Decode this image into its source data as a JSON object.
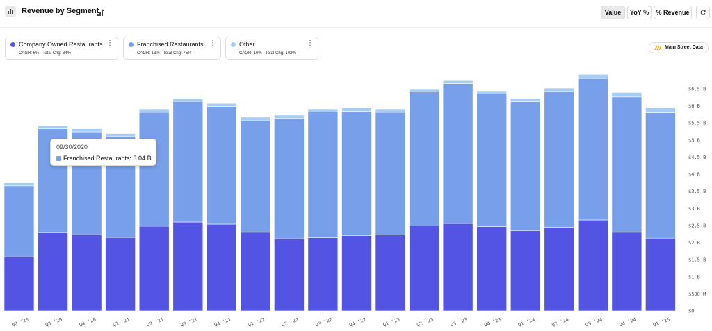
{
  "header": {
    "title": "Revenue by Segment",
    "buttons": {
      "value": "Value",
      "yoy": "YoY %",
      "pct_revenue": "% Revenue"
    }
  },
  "legend_cards": [
    {
      "name": "Company Owned Restaurants",
      "cagr": "CAGR: 6%",
      "total_chg": "Total Chg: 34%",
      "color": "#5353e4"
    },
    {
      "name": "Franchised Restaurants",
      "cagr": "CAGR: 13%",
      "total_chg": "Total Chg: 75%",
      "color": "#779fea"
    },
    {
      "name": "Other",
      "cagr": "CAGR: 16%",
      "total_chg": "Total Chg: 102%",
      "color": "#a7cdf5"
    }
  ],
  "badge": {
    "label": "Main Street Data"
  },
  "tooltip": {
    "date": "09/30/2020",
    "text": "Franchised Restaurants: 3.04 B",
    "color": "#779fea"
  },
  "chart_data": {
    "type": "bar",
    "stacked": true,
    "categories": [
      "Q2 '20",
      "Q3 '20",
      "Q4 '20",
      "Q1 '21",
      "Q2 '21",
      "Q3 '21",
      "Q4 '21",
      "Q1 '22",
      "Q2 '22",
      "Q3 '22",
      "Q4 '22",
      "Q1 '23",
      "Q2 '23",
      "Q3 '23",
      "Q4 '23",
      "Q1 '24",
      "Q2 '24",
      "Q3 '24",
      "Q4 '24",
      "Q1 '25"
    ],
    "series": [
      {
        "name": "Company Owned Restaurants",
        "color": "#5353e4",
        "values": [
          1.58,
          2.29,
          2.23,
          2.15,
          2.48,
          2.6,
          2.54,
          2.3,
          2.11,
          2.14,
          2.2,
          2.22,
          2.49,
          2.56,
          2.47,
          2.35,
          2.45,
          2.66,
          2.3,
          2.13
        ]
      },
      {
        "name": "Franchised Restaurants",
        "color": "#779fea",
        "values": [
          2.08,
          3.04,
          3.01,
          2.95,
          3.33,
          3.53,
          3.44,
          3.28,
          3.53,
          3.68,
          3.64,
          3.59,
          3.92,
          4.09,
          3.88,
          3.77,
          3.97,
          4.14,
          3.96,
          3.67
        ]
      },
      {
        "name": "Other",
        "color": "#a7cdf5",
        "values": [
          0.09,
          0.09,
          0.09,
          0.09,
          0.1,
          0.09,
          0.09,
          0.09,
          0.09,
          0.09,
          0.1,
          0.1,
          0.09,
          0.09,
          0.09,
          0.1,
          0.1,
          0.12,
          0.13,
          0.15
        ]
      }
    ],
    "ylim": [
      0,
      6.5
    ],
    "y_ticks": [
      0,
      0.5,
      1,
      1.5,
      2,
      2.5,
      3,
      3.5,
      4,
      4.5,
      5,
      5.5,
      6,
      6.5
    ],
    "y_tick_labels": [
      "$0",
      "$500 M",
      "$1 B",
      "$1.5 B",
      "$2 B",
      "$2.5 B",
      "$3 B",
      "$3.5 B",
      "$4 B",
      "$4.5 B",
      "$5 B",
      "$5.5 B",
      "$6 B",
      "$6.5 B"
    ],
    "legend_position": "top-left",
    "grid": false
  }
}
